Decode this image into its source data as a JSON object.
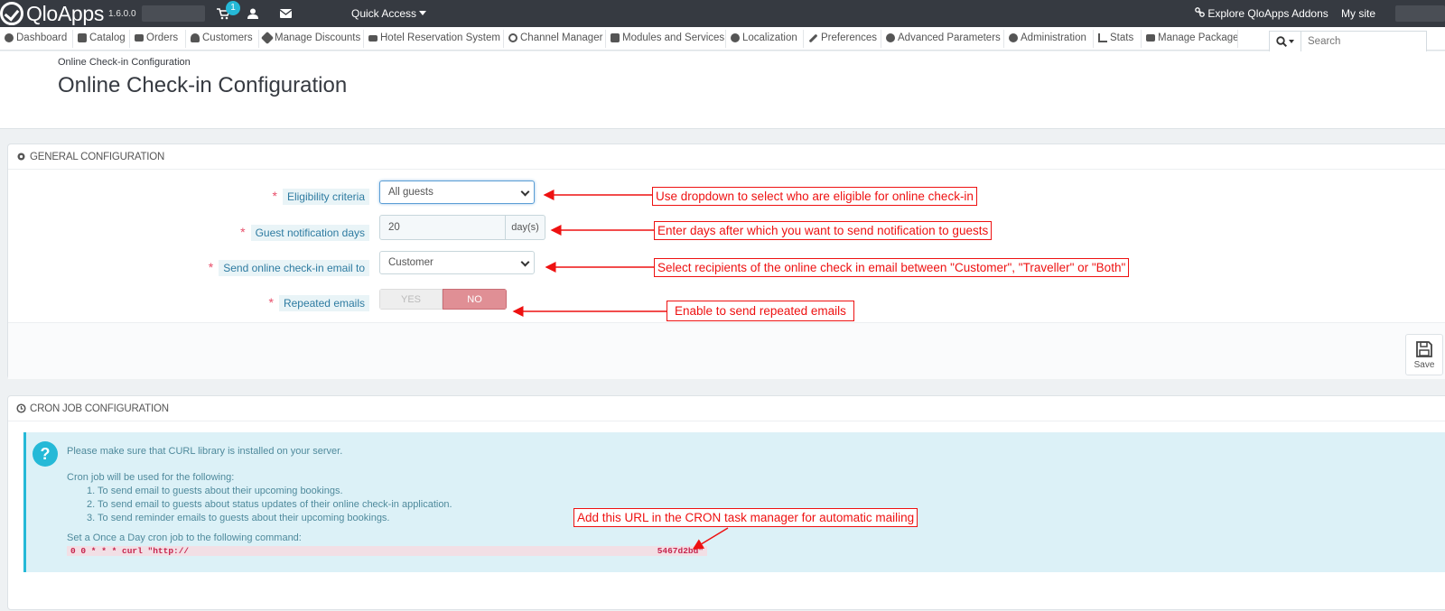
{
  "topbar": {
    "brand": "QloApps",
    "version": "1.6.0.0",
    "cart_badge": "1",
    "quick_access": "Quick Access",
    "explore_addons": "Explore QloApps Addons",
    "my_site": "My site"
  },
  "nav": {
    "items": [
      {
        "label": "Dashboard",
        "icon": "dashboard-icon"
      },
      {
        "label": "Catalog",
        "icon": "book-icon"
      },
      {
        "label": "Orders",
        "icon": "credit-card-icon"
      },
      {
        "label": "Customers",
        "icon": "users-icon"
      },
      {
        "label": "Manage Discounts",
        "icon": "tag-icon"
      },
      {
        "label": "Hotel Reservation System",
        "icon": "bed-icon"
      },
      {
        "label": "Channel Manager",
        "icon": "refresh-icon"
      },
      {
        "label": "Modules and Services",
        "icon": "puzzle-icon"
      },
      {
        "label": "Localization",
        "icon": "globe-icon"
      },
      {
        "label": "Preferences",
        "icon": "wrench-icon"
      },
      {
        "label": "Advanced Parameters",
        "icon": "cogs-icon"
      },
      {
        "label": "Administration",
        "icon": "cog-icon"
      },
      {
        "label": "Stats",
        "icon": "bar-chart-icon"
      },
      {
        "label": "Manage Package",
        "icon": "suitcase-icon"
      }
    ],
    "search_placeholder": "Search"
  },
  "header": {
    "breadcrumb": "Online Check-in Configuration",
    "title": "Online Check-in Configuration"
  },
  "general": {
    "heading": "GENERAL CONFIGURATION",
    "eligibility_label": "Eligibility criteria",
    "eligibility_value": "All guests",
    "notification_label": "Guest notification days",
    "notification_value": "20",
    "notification_unit": "day(s)",
    "send_to_label": "Send online check-in email to",
    "send_to_value": "Customer",
    "repeated_label": "Repeated emails",
    "repeated_yes": "YES",
    "repeated_no": "NO",
    "repeated_state": "NO",
    "save_label": "Save"
  },
  "cron": {
    "heading": "CRON JOB CONFIGURATION",
    "curl_notice": "Please make sure that CURL library is installed on your server.",
    "intro": "Cron job will be used for the following:",
    "items": [
      "1. To send email to guests about their upcoming bookings.",
      "2. To send email to guests about status updates of their online check-in application.",
      "3. To send reminder emails to guests about their upcoming bookings."
    ],
    "set_label": "Set a Once a Day cron job to the following command:",
    "command_start": "0 0 * * * curl \"http://",
    "command_end": "5467d2bd\""
  },
  "annotations": {
    "eligibility": "Use dropdown to select who are eligible for online check-in",
    "notification": "Enter days after which you want to send notification to guests",
    "recipients": "Select recipients of the online check in email between \"Customer\", \"Traveller\" or \"Both\"",
    "repeated": "Enable to send repeated emails",
    "cron_url": "Add this URL in the CRON task manager for automatic mailing"
  },
  "colors": {
    "topbar": "#363a41",
    "accent": "#25b9d7",
    "toggle_no": "#e08f95",
    "annotation": "#ee1111"
  }
}
